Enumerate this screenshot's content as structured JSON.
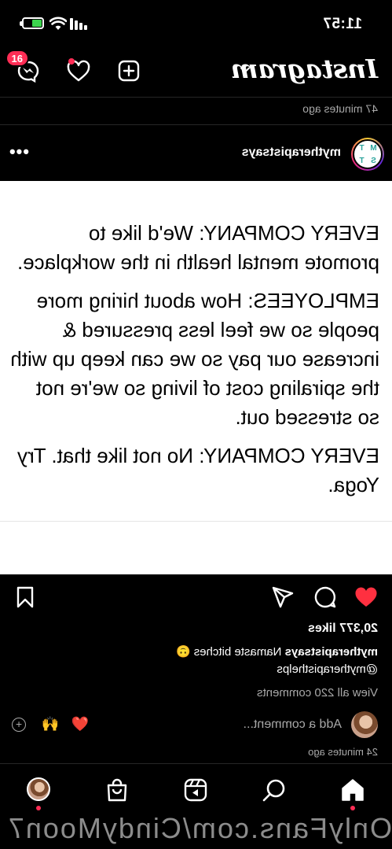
{
  "status_bar": {
    "time": "11:57"
  },
  "header": {
    "logo": "Instagram",
    "notification_count": "16"
  },
  "feed": {
    "previous_post_time": "47 minutes ago"
  },
  "post": {
    "username": "mytherapistsays",
    "avatar_letters": [
      "M",
      "T",
      "S",
      "T"
    ],
    "text_paragraphs": [
      "EVERY COMPANY: We'd like to promote mental health in the workplace.",
      "EMPLOYEES: How about hiring more people so we feel less pressured & increase our pay so we can keep up with the spiraling cost of living so we're not so stressed out.",
      "EVERY COMPANY: No not like that. Try Yoga."
    ],
    "likes": "20,377 likes",
    "caption_user": "mytherapistsays",
    "caption_text": "Namaste bitches 🙃",
    "caption_mention": "@mytherapisthelps",
    "view_comments": "View all 220 comments",
    "add_comment_placeholder": "Add a comment...",
    "quick_emojis": [
      "❤️",
      "🙌"
    ],
    "time_ago": "24 minutes ago"
  },
  "watermark": "OnlyFans.com/CindyMoon7"
}
